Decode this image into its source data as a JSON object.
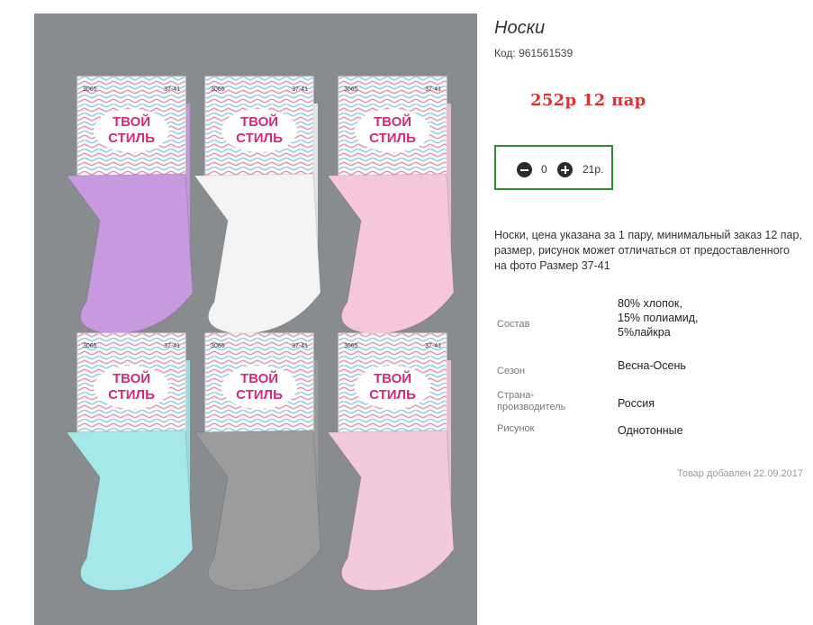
{
  "product": {
    "title": "Носки",
    "code": "Код: 961561539",
    "price": "252р  12 пар",
    "quantity": "0",
    "unit_price": "21р.",
    "description": "Носки, цена указана за 1 пару, минимальный заказ 12 пар, размер, рисунок может отличаться от предоставленного на фото Размер 37-41",
    "added": "Товар добавлен 22.09.2017"
  },
  "specs": [
    {
      "label": "Состав",
      "value": "80% хлопок, 15% полиамид, 5%лайкра"
    },
    {
      "label": "Сезон",
      "value": "Весна-Осень"
    },
    {
      "label": "Страна-производитель",
      "value": "Россия"
    },
    {
      "label": "Рисунок",
      "value": "Однотонные"
    }
  ],
  "photo": {
    "brand_line1": "ТВОЙ",
    "brand_line2": "СТИЛЬ",
    "model": "3065",
    "size": "37-41",
    "sock_colors": [
      "#c79ae0",
      "#f4f4f4",
      "#f6c6dc",
      "#a6e8ea",
      "#9c9c9c",
      "#f3cadb"
    ]
  }
}
